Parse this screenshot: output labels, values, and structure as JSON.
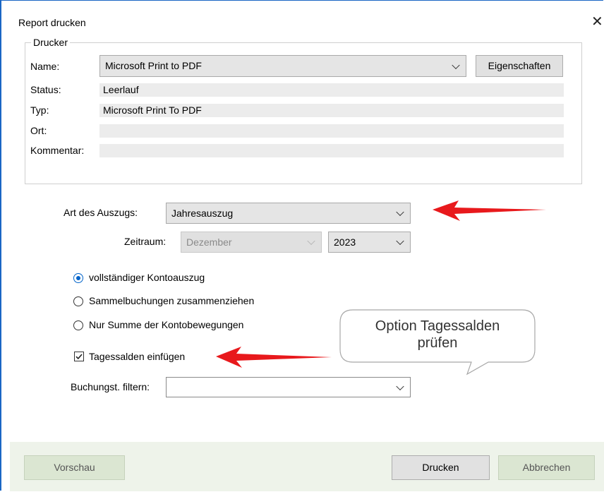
{
  "dialog": {
    "title": "Report drucken",
    "close_glyph": "✕"
  },
  "printer": {
    "group_title": "Drucker",
    "name_label": "Name:",
    "name_value": "Microsoft Print to PDF",
    "properties_button": "Eigenschaften",
    "status_label": "Status:",
    "status_value": "Leerlauf",
    "type_label": "Typ:",
    "type_value": "Microsoft Print To PDF",
    "location_label": "Ort:",
    "location_value": "",
    "comment_label": "Kommentar:",
    "comment_value": ""
  },
  "statement": {
    "type_label": "Art des Auszugs:",
    "type_value": "Jahresauszug",
    "period_label": "Zeitraum:",
    "month_value": "Dezember",
    "year_value": "2023"
  },
  "options": {
    "radio_full": "vollständiger Kontoauszug",
    "radio_collect": "Sammelbuchungen zusammenziehen",
    "radio_sum": "Nur Summe der Kontobewegungen",
    "selected": "radio_full",
    "checkbox_daily": "Tagessalden einfügen",
    "checkbox_daily_checked": true,
    "filter_label": "Buchungst. filtern:",
    "filter_value": ""
  },
  "callout": {
    "text_line1": "Option Tagessalden",
    "text_line2": "prüfen"
  },
  "footer": {
    "preview_button": "Vorschau",
    "print_button": "Drucken",
    "cancel_button": "Abbrechen"
  },
  "colors": {
    "arrow": "#e8191c",
    "accent": "#0063c9",
    "footer_bg": "#eef3ea"
  }
}
